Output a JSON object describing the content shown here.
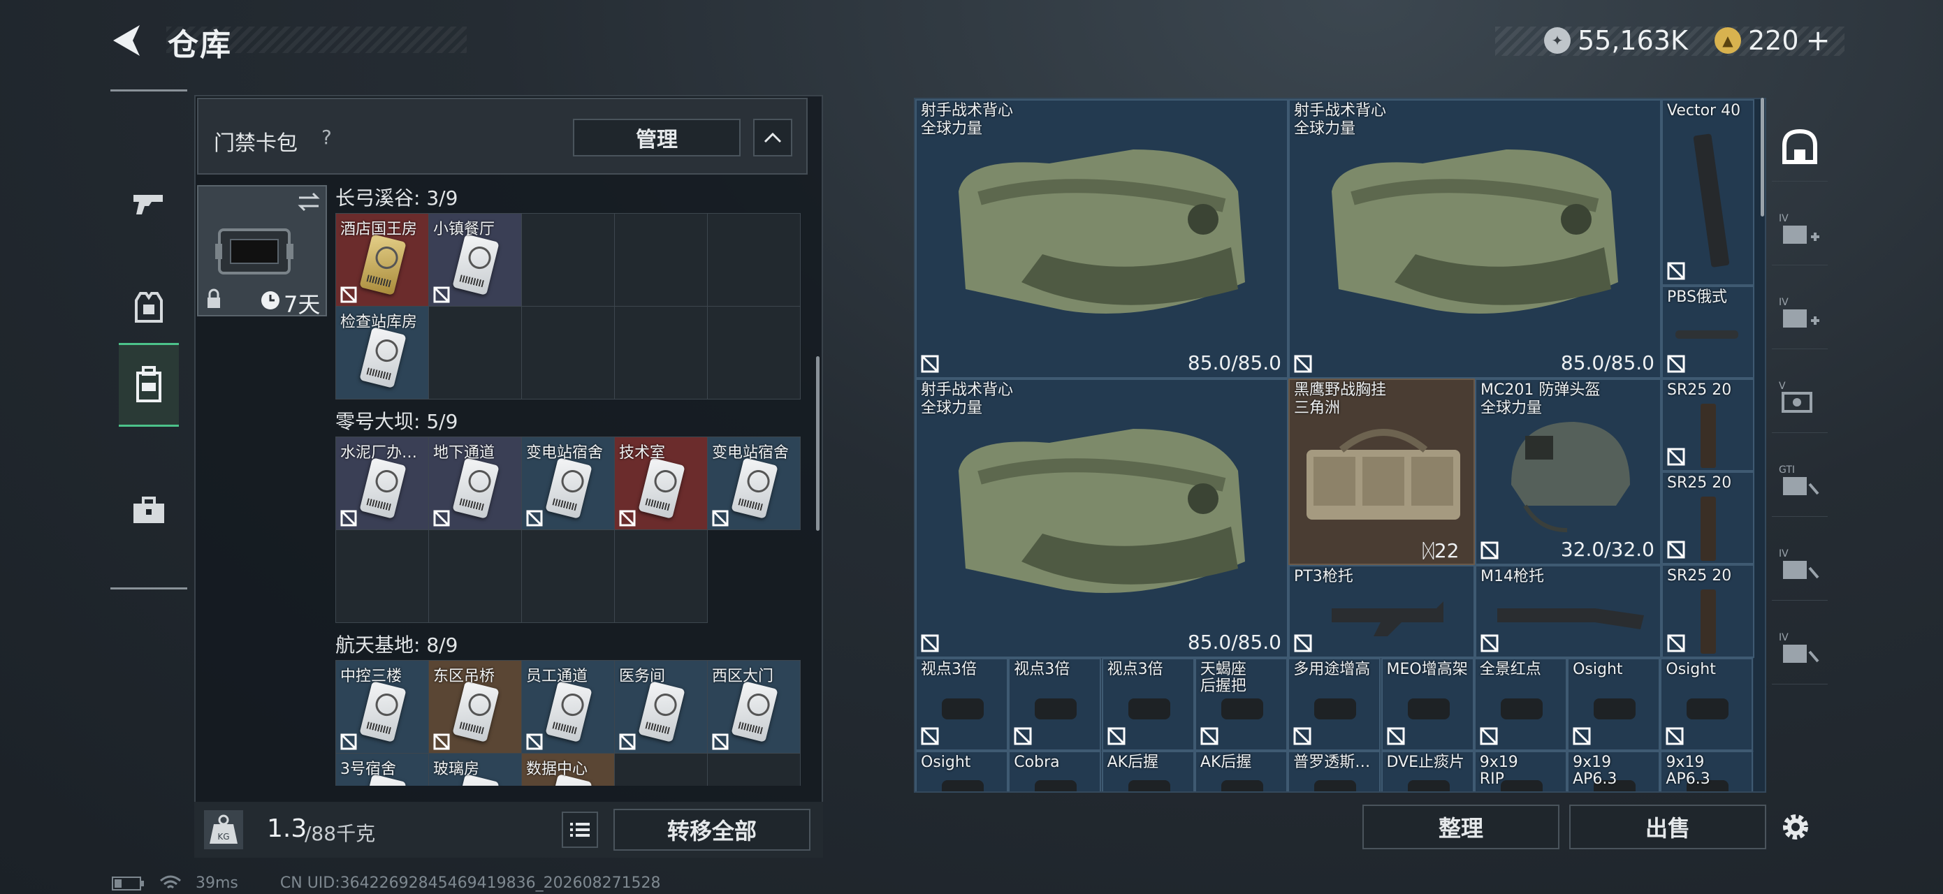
{
  "header": {
    "title": "仓库",
    "back_label": "back"
  },
  "currency": {
    "silver": "55,163K",
    "gold": "220",
    "gold_plus": "+"
  },
  "cardpack": {
    "title": "门禁卡包",
    "help": "?",
    "manage": "管理",
    "case_days": "7天"
  },
  "sections": [
    {
      "title": "长弓溪谷: 3/9",
      "cards": [
        {
          "label": "酒店国王房",
          "variant": "gold",
          "bg": "#6b2c2c"
        },
        {
          "label": "小镇餐厅",
          "bg": "#3a3f55"
        },
        {
          "label": "检查站库房",
          "bg": "#2d4457"
        }
      ]
    },
    {
      "title": "零号大坝: 5/9",
      "cards": [
        {
          "label": "水泥厂办…",
          "bg": "#3a3f55"
        },
        {
          "label": "地下通道",
          "bg": "#3a3f55"
        },
        {
          "label": "变电站宿舍",
          "bg": "#2d4457"
        },
        {
          "label": "技术室",
          "bg": "#6b2c2c"
        },
        {
          "label": "变电站宿舍",
          "bg": "#2d4457"
        }
      ]
    },
    {
      "title": "航天基地: 8/9",
      "cards": [
        {
          "label": "中控三楼",
          "bg": "#2d4457"
        },
        {
          "label": "东区吊桥",
          "bg": "#5a4634"
        },
        {
          "label": "员工通道",
          "bg": "#2d4457"
        },
        {
          "label": "医务间",
          "bg": "#2d4457"
        },
        {
          "label": "西区大门",
          "bg": "#2d4457"
        },
        {
          "label": "3号宿舍",
          "bg": "#2d4457"
        },
        {
          "label": "玻璃房",
          "bg": "#2d4457"
        },
        {
          "label": "数据中心",
          "bg": "#5a4634"
        }
      ]
    }
  ],
  "weight": {
    "value": "1.3",
    "max": "/88千克",
    "transfer": "转移全部"
  },
  "stash": {
    "vests": [
      {
        "name": "射手战术背心",
        "sub": "全球力量",
        "dur": "85.0/85.0"
      },
      {
        "name": "射手战术背心",
        "sub": "全球力量",
        "dur": "85.0/85.0"
      },
      {
        "name": "射手战术背心",
        "sub": "全球力量",
        "dur": "85.0/85.0"
      }
    ],
    "rig": {
      "name": "黑鹰野战胸挂",
      "sub": "三角洲",
      "count": "22"
    },
    "helmet": {
      "name": "MC201 防弹头盔",
      "sub": "全球力量",
      "dur": "32.0/32.0"
    },
    "mags": [
      {
        "name": "Vector 40"
      },
      {
        "name": "PBS俄式"
      },
      {
        "name": "SR25 20"
      },
      {
        "name": "SR25 20"
      },
      {
        "name": "SR25 20"
      }
    ],
    "stocks": [
      {
        "name": "PT3枪托"
      },
      {
        "name": "M14枪托"
      }
    ],
    "row_small": [
      {
        "name": "视点3倍"
      },
      {
        "name": "视点3倍"
      },
      {
        "name": "视点3倍"
      },
      {
        "name": "天蝎座",
        "sub": "后握把"
      },
      {
        "name": "多用途增高"
      },
      {
        "name": "MEO增高架"
      },
      {
        "name": "全景红点"
      },
      {
        "name": "Osight"
      },
      {
        "name": "Osight"
      }
    ],
    "row_bottom": [
      {
        "name": "Osight"
      },
      {
        "name": "Cobra"
      },
      {
        "name": "AK后握"
      },
      {
        "name": "AK后握"
      },
      {
        "name": "普罗透斯…"
      },
      {
        "name": "DVE止痰片"
      },
      {
        "name": "9x19",
        "sub": "RIP"
      },
      {
        "name": "9x19",
        "sub": "AP6.3"
      },
      {
        "name": "9x19",
        "sub": "AP6.3"
      }
    ]
  },
  "actions": {
    "sort": "整理",
    "sell": "出售"
  },
  "status": {
    "ping": "39ms",
    "uid": "CN UID:364226928454694198​36_202608271528"
  }
}
